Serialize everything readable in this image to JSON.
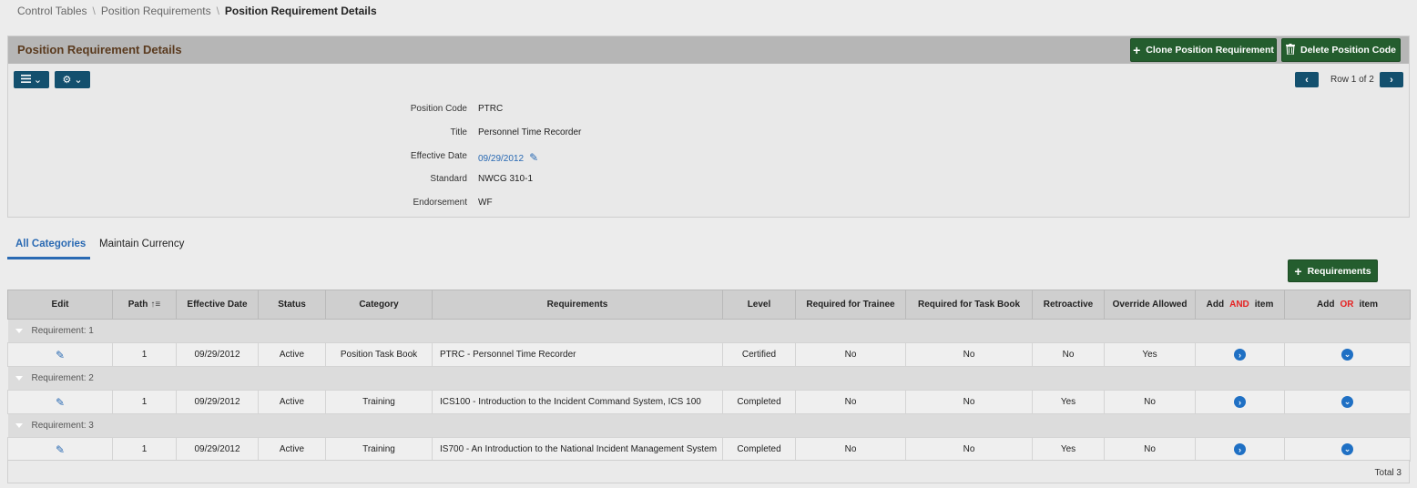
{
  "breadcrumb": {
    "items": [
      "Control Tables",
      "Position Requirements"
    ],
    "current": "Position Requirement Details",
    "separator": "\\"
  },
  "panel": {
    "title": "Position Requirement Details",
    "clone_button": "Clone Position Requirement",
    "delete_button": "Delete Position Code",
    "menu_icon": "list-icon",
    "settings_icon": "gear-icon",
    "pager": {
      "text": "Row 1 of 2",
      "prev": "‹",
      "next": "›"
    }
  },
  "details": {
    "position_code": {
      "label": "Position Code",
      "value": "PTRC"
    },
    "title": {
      "label": "Title",
      "value": "Personnel Time Recorder"
    },
    "effective_date": {
      "label": "Effective Date",
      "value": "09/29/2012"
    },
    "standard": {
      "label": "Standard",
      "value": "NWCG 310-1"
    },
    "endorsement": {
      "label": "Endorsement",
      "value": "WF"
    }
  },
  "tabs": [
    {
      "label": "All Categories",
      "active": true
    },
    {
      "label": "Maintain Currency",
      "active": false
    }
  ],
  "requirements_button": "Requirements",
  "table": {
    "headers": {
      "edit": "Edit",
      "path": "Path",
      "effective_date": "Effective Date",
      "status": "Status",
      "category": "Category",
      "requirements": "Requirements",
      "level": "Level",
      "required_trainee": "Required for Trainee",
      "required_taskbook": "Required for Task Book",
      "retroactive": "Retroactive",
      "override": "Override Allowed",
      "add_and_prefix": "Add",
      "add_and_keyword": "AND",
      "add_and_suffix": "item",
      "add_or_prefix": "Add",
      "add_or_keyword": "OR",
      "add_or_suffix": "item"
    },
    "groups": [
      {
        "label": "Requirement: 1",
        "row": {
          "path": "1",
          "effective_date": "09/29/2012",
          "status": "Active",
          "category": "Position Task Book",
          "requirement": "PTRC - Personnel Time Recorder",
          "level": "Certified",
          "trainee": "No",
          "taskbook": "No",
          "retroactive": "No",
          "override": "Yes"
        }
      },
      {
        "label": "Requirement: 2",
        "row": {
          "path": "1",
          "effective_date": "09/29/2012",
          "status": "Active",
          "category": "Training",
          "requirement": "ICS100 - Introduction to the Incident Command System, ICS 100",
          "level": "Completed",
          "trainee": "No",
          "taskbook": "No",
          "retroactive": "Yes",
          "override": "No"
        }
      },
      {
        "label": "Requirement: 3",
        "row": {
          "path": "1",
          "effective_date": "09/29/2012",
          "status": "Active",
          "category": "Training",
          "requirement": "IS700 - An Introduction to the National Incident Management System",
          "level": "Completed",
          "trainee": "No",
          "taskbook": "No",
          "retroactive": "Yes",
          "override": "No"
        }
      }
    ],
    "total": "Total 3"
  },
  "colors": {
    "green": "#245d2e",
    "navy": "#13506e",
    "link": "#2a6ab3",
    "red": "#e52323"
  }
}
